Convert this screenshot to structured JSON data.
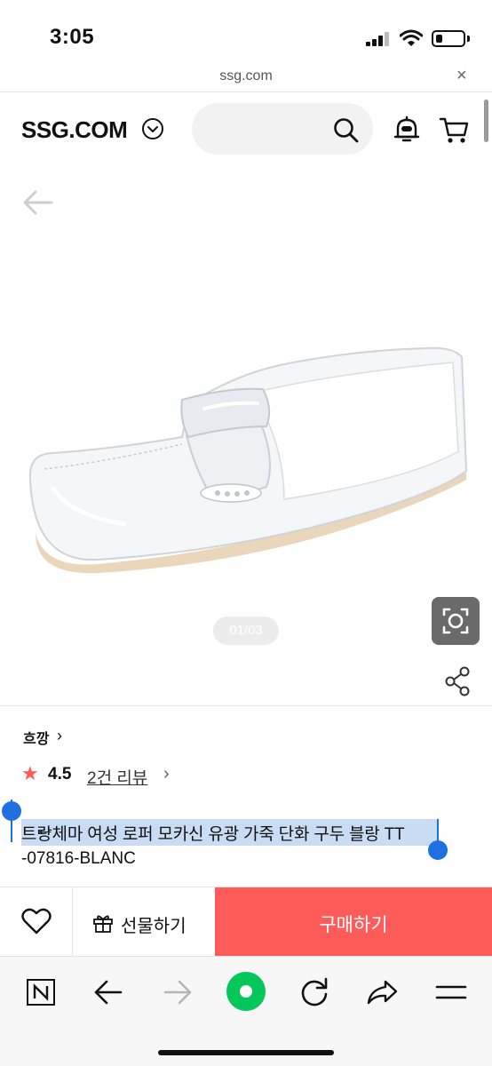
{
  "status_bar": {
    "time": "3:05",
    "battery_level": 0.25,
    "icons": [
      "signal-icon",
      "wifi-icon",
      "battery-icon"
    ]
  },
  "url_bar": {
    "url": "ssg.com",
    "close_glyph": "×"
  },
  "header": {
    "logo": "SSG.COM",
    "icons": [
      "chevron-down-icon",
      "search-icon",
      "alarm-icon",
      "cart-icon"
    ]
  },
  "gallery": {
    "page_indicator": "01/03",
    "icons": [
      "back-arrow-icon",
      "lens-search-icon",
      "share-icon"
    ]
  },
  "product": {
    "brand": "흐깡",
    "brand_chevron": "›",
    "rating_star": "★",
    "rating": "4.5",
    "review_link": "2건 리뷰",
    "review_chevron": "›",
    "title_line1": "트랑체마 여성 로퍼 모카신 유광 가죽 단화 구두 블랑 TT",
    "title_line2": "-07816-BLANC",
    "selection_arrow": "←"
  },
  "buy_bar": {
    "gift_label": "선물하기",
    "purchase_label": "구매하기"
  },
  "colors": {
    "accent": "#ff5b59",
    "selection": "#c9dcf3",
    "handle": "#1f6fe0",
    "naver_green": "#03c75a"
  },
  "toolbar": {
    "items": [
      "naver-n-icon",
      "back-icon",
      "forward-icon",
      "green-dot-icon",
      "refresh-icon",
      "share-arrow-icon",
      "menu-icon"
    ]
  }
}
